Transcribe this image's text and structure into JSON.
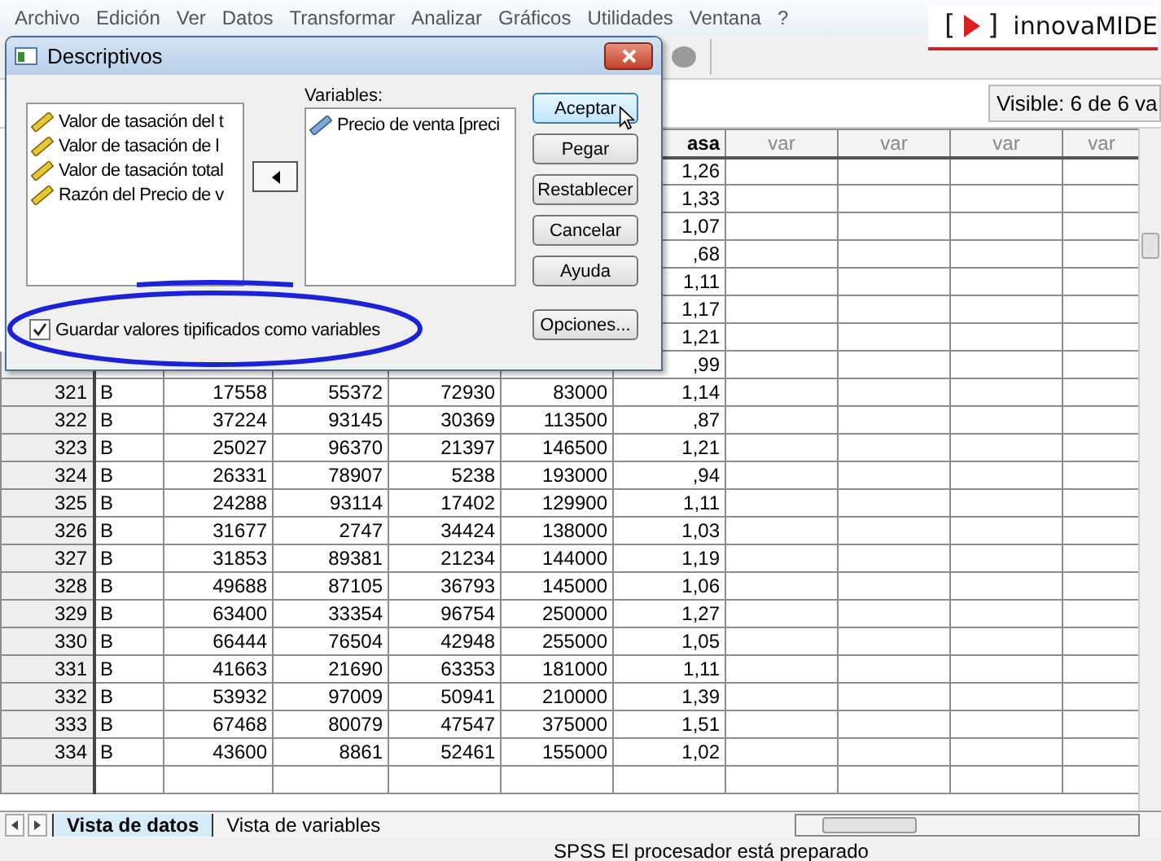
{
  "menu": [
    "Archivo",
    "Edición",
    "Ver",
    "Datos",
    "Transformar",
    "Analizar",
    "Gráficos",
    "Utilidades",
    "Ventana",
    "?"
  ],
  "logo": {
    "open": "[",
    "close": "]",
    "name": "innovaMIDE"
  },
  "visible_count": "Visible: 6 de 6 va",
  "columns": [
    "asa",
    "var",
    "var",
    "var",
    "var"
  ],
  "rows": [
    {
      "tasa": "1,26"
    },
    {
      "tasa": "1,33"
    },
    {
      "tasa": "1,07"
    },
    {
      "tasa": ",68"
    },
    {
      "tasa": "1,11"
    },
    {
      "tasa": "1,17"
    },
    {
      "tasa": "1,21"
    },
    {
      "tasa": ",99"
    },
    {
      "num": "321",
      "cells": [
        "B",
        "17558",
        "55372",
        "72930",
        "83000"
      ],
      "tasa": "1,14"
    },
    {
      "num": "322",
      "cells": [
        "B",
        "37224",
        "93145",
        "30369",
        "113500"
      ],
      "tasa": ",87"
    },
    {
      "num": "323",
      "cells": [
        "B",
        "25027",
        "96370",
        "21397",
        "146500"
      ],
      "tasa": "1,21"
    },
    {
      "num": "324",
      "cells": [
        "B",
        "26331",
        "78907",
        "5238",
        "193000"
      ],
      "tasa": ",94"
    },
    {
      "num": "325",
      "cells": [
        "B",
        "24288",
        "93114",
        "17402",
        "129900"
      ],
      "tasa": "1,11"
    },
    {
      "num": "326",
      "cells": [
        "B",
        "31677",
        "2747",
        "34424",
        "138000"
      ],
      "tasa": "1,03"
    },
    {
      "num": "327",
      "cells": [
        "B",
        "31853",
        "89381",
        "21234",
        "144000"
      ],
      "tasa": "1,19"
    },
    {
      "num": "328",
      "cells": [
        "B",
        "49688",
        "87105",
        "36793",
        "145000"
      ],
      "tasa": "1,06"
    },
    {
      "num": "329",
      "cells": [
        "B",
        "63400",
        "33354",
        "96754",
        "250000"
      ],
      "tasa": "1,27"
    },
    {
      "num": "330",
      "cells": [
        "B",
        "66444",
        "76504",
        "42948",
        "255000"
      ],
      "tasa": "1,05"
    },
    {
      "num": "331",
      "cells": [
        "B",
        "41663",
        "21690",
        "63353",
        "181000"
      ],
      "tasa": "1,11"
    },
    {
      "num": "332",
      "cells": [
        "B",
        "53932",
        "97009",
        "50941",
        "210000"
      ],
      "tasa": "1,39"
    },
    {
      "num": "333",
      "cells": [
        "B",
        "67468",
        "80079",
        "47547",
        "375000"
      ],
      "tasa": "1,51"
    },
    {
      "num": "334",
      "cells": [
        "B",
        "43600",
        "8861",
        "52461",
        "155000"
      ],
      "tasa": "1,02"
    }
  ],
  "tabs": [
    {
      "label": "Vista de datos",
      "selected": true
    },
    {
      "label": "Vista de variables",
      "selected": false
    }
  ],
  "status": "SPSS El procesador está preparado",
  "dialog": {
    "title": "Descriptivos",
    "source_items": [
      "Valor de tasación del t",
      "Valor de tasación de l",
      "Valor de tasación total",
      "Razón del Precio de v"
    ],
    "variables_label": "Variables:",
    "selected_items": [
      "Precio de venta [preci"
    ],
    "buttons": [
      {
        "label": "Aceptar",
        "focused": true
      },
      {
        "label": "Pegar",
        "focused": false
      },
      {
        "label": "Restablecer",
        "focused": false
      },
      {
        "label": "Cancelar",
        "focused": false
      },
      {
        "label": "Ayuda",
        "focused": false
      }
    ],
    "options_button": "Opciones...",
    "checkbox": {
      "label": "Guardar valores tipificados como variables",
      "checked": true
    }
  }
}
